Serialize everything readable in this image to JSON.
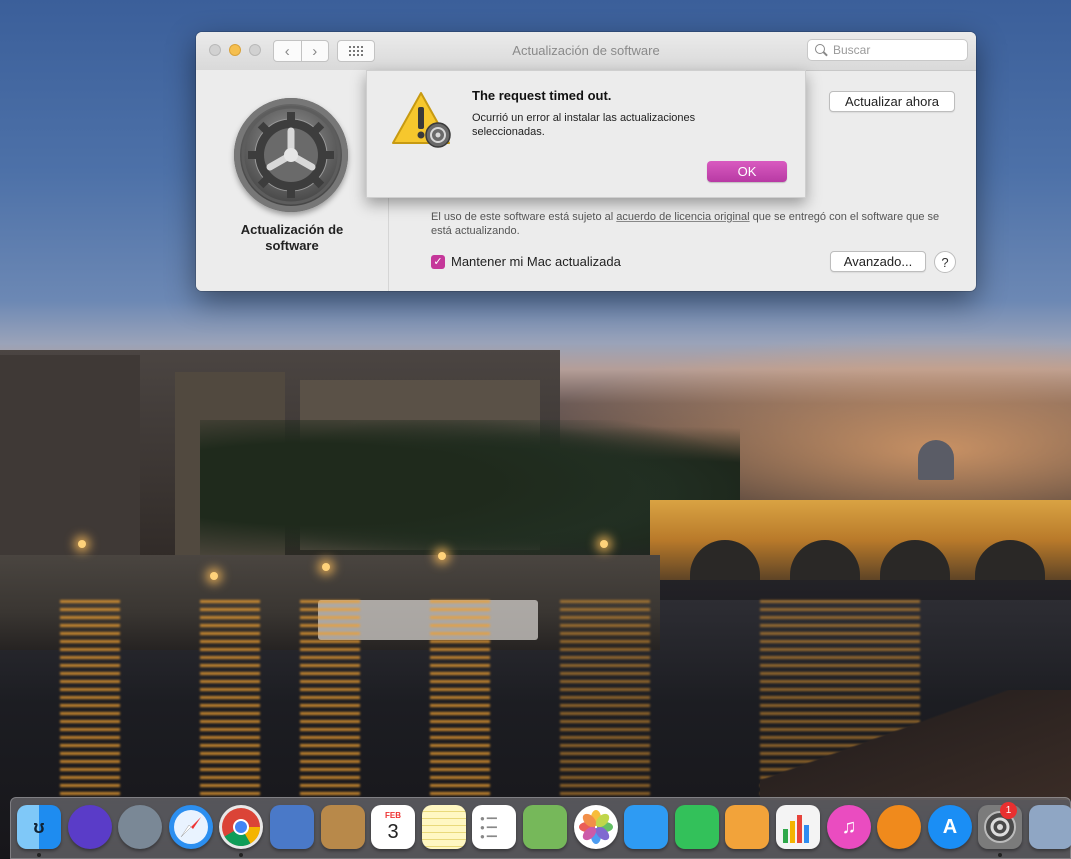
{
  "window": {
    "title": "Actualización de software",
    "search_placeholder": "Buscar",
    "nav_back": "‹",
    "nav_forward": "›",
    "pane_label": "Actualización de software",
    "update_now_button": "Actualizar ahora",
    "license_text_before": "El uso de este software está sujeto al ",
    "license_link": "acuerdo de licencia original",
    "license_text_after": " que se entregó con el software que se está actualizando.",
    "keep_updated_label": "Mantener mi Mac actualizada",
    "keep_updated_checked": true,
    "advanced_button": "Avanzado...",
    "help_button": "?"
  },
  "alert": {
    "title": "The request timed out.",
    "message": "Ocurrió un error al instalar las actualizaciones seleccionadas.",
    "ok_button": "OK"
  },
  "dock": {
    "calendar_month": "FEB",
    "calendar_day": "3",
    "system_prefs_badge": "1",
    "items": [
      {
        "name": "finder",
        "color": "#1e8cf0"
      },
      {
        "name": "siri",
        "color": "#5a3cc8"
      },
      {
        "name": "launchpad",
        "color": "#7a8896"
      },
      {
        "name": "safari",
        "color": "#2c8ff0"
      },
      {
        "name": "chrome",
        "color": "#e8e8e8"
      },
      {
        "name": "mail",
        "color": "#4a79c8"
      },
      {
        "name": "contacts",
        "color": "#b8894a"
      },
      {
        "name": "calendar",
        "color": "#ffffff"
      },
      {
        "name": "notes",
        "color": "#f7dd58"
      },
      {
        "name": "reminders",
        "color": "#ffffff"
      },
      {
        "name": "maps",
        "color": "#76b85a"
      },
      {
        "name": "photos",
        "color": "#ffffff"
      },
      {
        "name": "messages",
        "color": "#2e9bf3"
      },
      {
        "name": "facetime",
        "color": "#33c15a"
      },
      {
        "name": "pages",
        "color": "#f2a33a"
      },
      {
        "name": "numbers",
        "color": "#2fa84a"
      },
      {
        "name": "itunes",
        "color": "#ea4cc0"
      },
      {
        "name": "books",
        "color": "#f08a1c"
      },
      {
        "name": "app-store",
        "color": "#1a8ef5"
      },
      {
        "name": "system-preferences",
        "color": "#7b7b7b"
      },
      {
        "name": "preview",
        "color": "#8fa6c4"
      }
    ]
  },
  "accent_color": "#c5379a"
}
